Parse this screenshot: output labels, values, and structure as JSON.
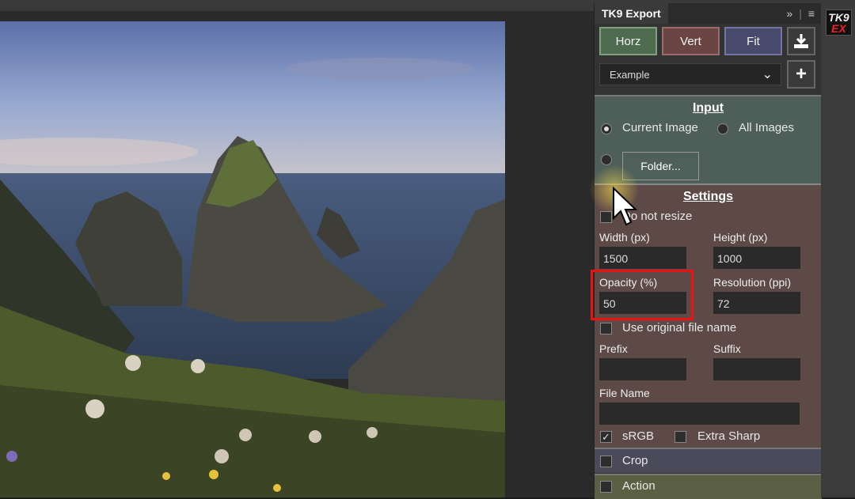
{
  "panel": {
    "title": "TK9 Export",
    "collapse_icon": "double-chevron-right-icon",
    "menu_icon": "hamburger-menu-icon"
  },
  "buttons": {
    "horz": "Horz",
    "vert": "Vert",
    "fit": "Fit",
    "download_icon": "download-icon",
    "add_icon": "plus-icon"
  },
  "preset": {
    "value": "Example"
  },
  "input": {
    "title": "Input",
    "current_image": "Current Image",
    "all_images": "All Images",
    "folder": "Folder...",
    "selected": "current_image"
  },
  "settings": {
    "title": "Settings",
    "do_not_resize": "Do not resize",
    "width_label": "Width (px)",
    "width_value": "1500",
    "height_label": "Height (px)",
    "height_value": "1000",
    "opacity_label": "Opacity (%)",
    "opacity_value": "50",
    "resolution_label": "Resolution (ppi)",
    "resolution_value": "72",
    "use_original": "Use original file name",
    "prefix_label": "Prefix",
    "prefix_value": "",
    "suffix_label": "Suffix",
    "suffix_value": "",
    "file_name_label": "File Name",
    "file_name_value": "",
    "srgb": "sRGB",
    "srgb_checked": true,
    "extra_sharp": "Extra Sharp"
  },
  "crop": {
    "label": "Crop"
  },
  "action": {
    "label": "Action"
  },
  "sidebar": {
    "logo_line1": "TK9",
    "logo_line2": "EX"
  },
  "colors": {
    "highlight": "#e11111",
    "horz": "#4e6b4f",
    "vert": "#6b4543",
    "fit": "#474a6b"
  }
}
